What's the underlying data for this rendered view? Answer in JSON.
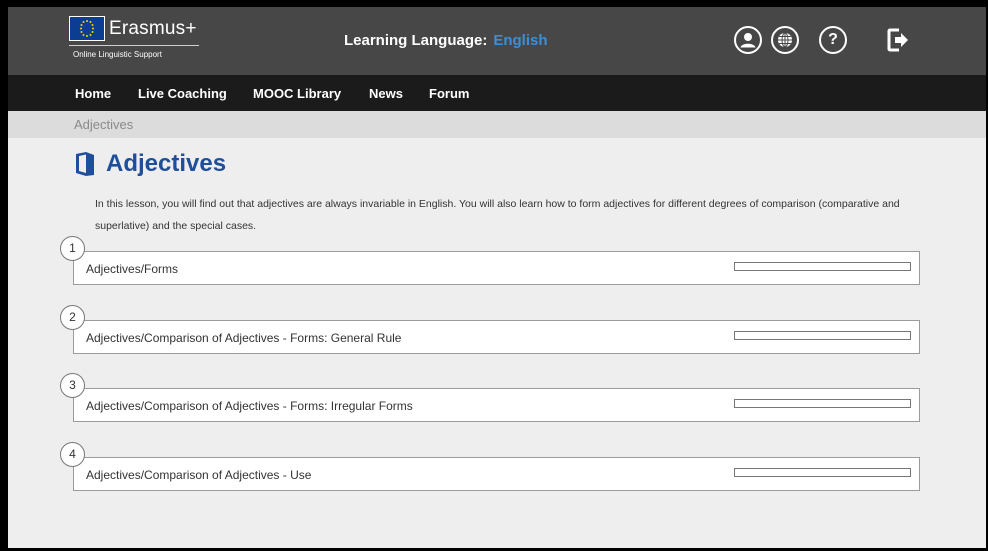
{
  "header": {
    "logo_word": "Erasmus+",
    "logo_subtitle": "Online Linguistic Support",
    "learning_language_label": "Learning Language:",
    "learning_language_value": "English",
    "help_glyph": "?",
    "icons": [
      "user-icon",
      "globe-icon",
      "help-icon",
      "logout-icon"
    ],
    "accent_color": "#3a8fd8"
  },
  "nav": {
    "items": [
      "Home",
      "Live Coaching",
      "MOOC Library",
      "News",
      "Forum"
    ]
  },
  "breadcrumb": "Adjectives",
  "page": {
    "title": "Adjectives",
    "title_color": "#1f4e9a",
    "intro": "In this lesson, you will find out that adjectives are always invariable in English. You will also learn how to form adjectives for different degrees of comparison (comparative and superlative) and the special cases."
  },
  "lessons": [
    {
      "number": "1",
      "title": "Adjectives/Forms",
      "progress": 0
    },
    {
      "number": "2",
      "title": "Adjectives/Comparison of Adjectives - Forms: General Rule",
      "progress": 0
    },
    {
      "number": "3",
      "title": "Adjectives/Comparison of Adjectives - Forms: Irregular Forms",
      "progress": 0
    },
    {
      "number": "4",
      "title": "Adjectives/Comparison of Adjectives - Use",
      "progress": 0
    }
  ]
}
